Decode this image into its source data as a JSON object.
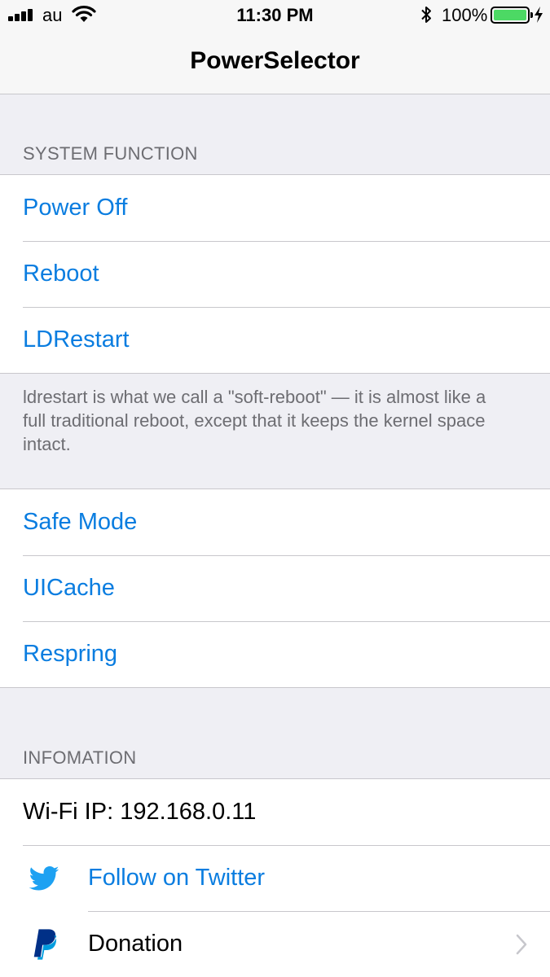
{
  "status_bar": {
    "carrier": "au",
    "time": "11:30 PM",
    "battery_percent": "100%",
    "battery_level": 1.0,
    "signal_bars": 4,
    "icons": [
      "signal-icon",
      "wifi-icon",
      "bluetooth-icon",
      "battery-icon",
      "charging-icon"
    ]
  },
  "nav": {
    "title": "PowerSelector"
  },
  "sections": {
    "system": {
      "header": "SYSTEM FUNCTION",
      "items": [
        {
          "label": "Power Off"
        },
        {
          "label": "Reboot"
        },
        {
          "label": "LDRestart"
        }
      ],
      "footer": "ldrestart is what we call a \"soft-reboot\" — it is almost like a full traditional reboot, except that it keeps the kernel space intact."
    },
    "system2": {
      "items": [
        {
          "label": "Safe Mode"
        },
        {
          "label": "UICache"
        },
        {
          "label": "Respring"
        }
      ]
    },
    "info": {
      "header": "INFOMATION",
      "wifi_ip": "Wi-Fi IP: 192.168.0.11",
      "items": [
        {
          "label": "Follow on Twitter",
          "icon": "twitter-icon"
        },
        {
          "label": "Donation",
          "icon": "paypal-icon"
        }
      ]
    }
  },
  "colors": {
    "link": "#0a7de0",
    "background": "#efeff4",
    "twitter": "#1da1f2",
    "paypal_dark": "#003087",
    "paypal_light": "#009cde",
    "battery": "#4cd964"
  }
}
